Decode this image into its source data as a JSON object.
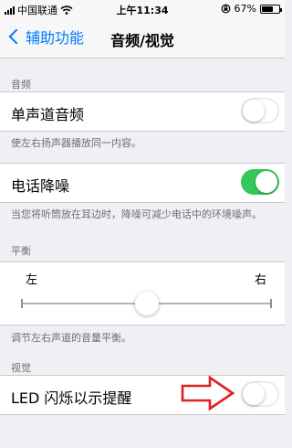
{
  "status_bar": {
    "carrier": "中国联通",
    "time": "上午11:34",
    "battery_text": "67%",
    "battery_level": 0.67
  },
  "nav": {
    "back_label": "辅助功能",
    "title": "音频/视觉"
  },
  "audio_section": {
    "header": "音频",
    "mono_label": "单声道音频",
    "mono_on": false,
    "mono_footer": "使左右扬声器播放同一内容。"
  },
  "noise_section": {
    "label": "电话降噪",
    "on": true,
    "footer": "当您将听筒放在耳边时，降噪可减少电话中的环境噪声。"
  },
  "balance_section": {
    "header": "平衡",
    "left_label": "左",
    "right_label": "右",
    "value": 0.5,
    "footer": "调节左右声道的音量平衡。"
  },
  "visual_section": {
    "header": "视觉",
    "led_label": "LED 闪烁以示提醒",
    "led_on": false
  },
  "colors": {
    "accent": "#007aff",
    "switch_on": "#34c759",
    "annotation_arrow": "#e02020"
  }
}
